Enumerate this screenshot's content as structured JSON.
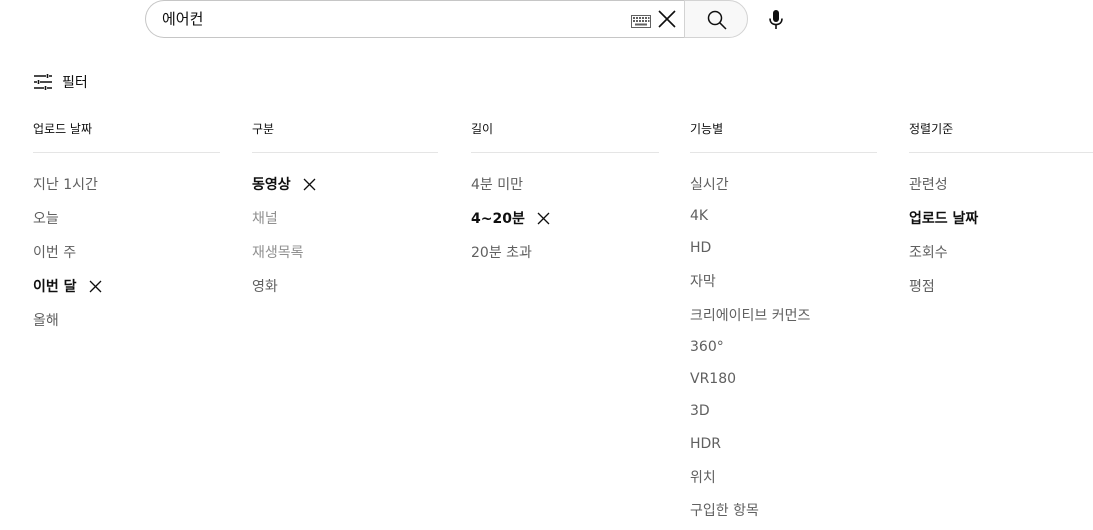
{
  "search": {
    "query": "에어컨"
  },
  "filter": {
    "label": "필터"
  },
  "groups": [
    {
      "header": "업로드 날짜",
      "options": [
        {
          "label": "지난 1시간",
          "state": "normal"
        },
        {
          "label": "오늘",
          "state": "normal"
        },
        {
          "label": "이번 주",
          "state": "normal"
        },
        {
          "label": "이번 달",
          "state": "active"
        },
        {
          "label": "올해",
          "state": "normal"
        }
      ]
    },
    {
      "header": "구분",
      "options": [
        {
          "label": "동영상",
          "state": "active"
        },
        {
          "label": "채널",
          "state": "disabled"
        },
        {
          "label": "재생목록",
          "state": "disabled"
        },
        {
          "label": "영화",
          "state": "normal"
        }
      ]
    },
    {
      "header": "길이",
      "options": [
        {
          "label": "4분 미만",
          "state": "normal"
        },
        {
          "label": "4~20분",
          "state": "active"
        },
        {
          "label": "20분 초과",
          "state": "normal"
        }
      ]
    },
    {
      "header": "기능별",
      "options": [
        {
          "label": "실시간",
          "state": "normal"
        },
        {
          "label": "4K",
          "state": "normal"
        },
        {
          "label": "HD",
          "state": "normal"
        },
        {
          "label": "자막",
          "state": "normal"
        },
        {
          "label": "크리에이티브 커먼즈",
          "state": "normal"
        },
        {
          "label": "360°",
          "state": "normal"
        },
        {
          "label": "VR180",
          "state": "normal"
        },
        {
          "label": "3D",
          "state": "normal"
        },
        {
          "label": "HDR",
          "state": "normal"
        },
        {
          "label": "위치",
          "state": "normal"
        },
        {
          "label": "구입한 항목",
          "state": "normal"
        }
      ]
    },
    {
      "header": "정렬기준",
      "options": [
        {
          "label": "관련성",
          "state": "normal"
        },
        {
          "label": "업로드 날짜",
          "state": "active"
        },
        {
          "label": "조회수",
          "state": "normal"
        },
        {
          "label": "평점",
          "state": "normal"
        }
      ]
    }
  ]
}
